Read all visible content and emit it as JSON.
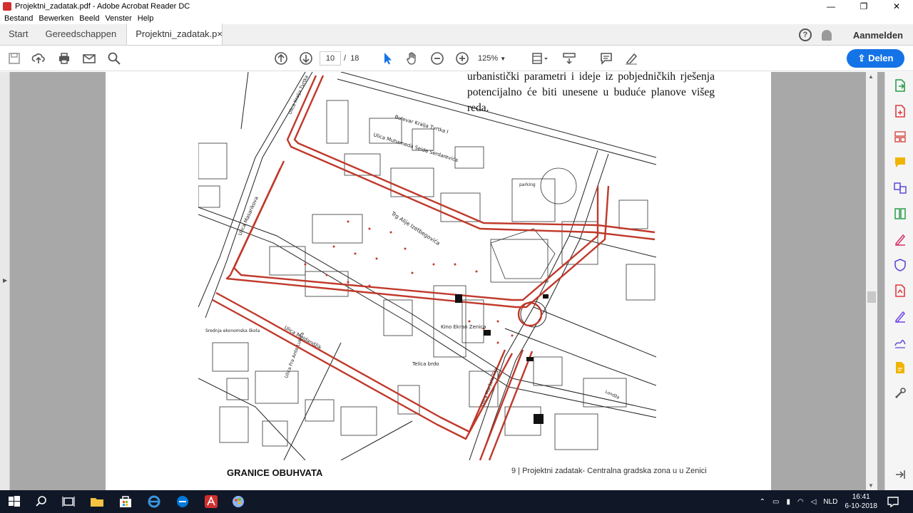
{
  "window": {
    "title": "Projektni_zadatak.pdf - Adobe Acrobat Reader DC",
    "minimize": "—",
    "maximize": "❐",
    "close": "✕"
  },
  "menu": [
    "Bestand",
    "Bewerken",
    "Beeld",
    "Venster",
    "Help"
  ],
  "tabs": {
    "home": "Start",
    "tools": "Gereedschappen",
    "document": "Projektni_zadatak.p",
    "close": "×"
  },
  "account": {
    "help": "?",
    "signin": "Aanmelden"
  },
  "toolbar": {
    "current_page": "10",
    "page_separator": "/",
    "total_pages": "18",
    "zoom": "125%",
    "share_label": "Delen"
  },
  "document": {
    "paragraph": "urbanistički parametri i ideje iz pobjedničkih rješenja potencijalno će biti unesene u buduće planove višeg reda.",
    "caption": "GRANICE OBUHVATA",
    "footer": "9 | Projektni zadatak- Centralna gradska zona u u Zenici",
    "map_labels": {
      "street1": "Bulevar Kralja Tvrtka I",
      "street2": "Ulica Muhameda Seida Serdarevića",
      "street3": "Trg Alije Izetbegovića",
      "street4": "Ulica Masarikova",
      "street5": "Ulica Mejdandžik",
      "cinema": "Kino Ekran Zenica",
      "hill": "Telica brdo",
      "school": "Srednja ekonomska škola",
      "street6": "Ulica Kralja Tvrtka",
      "street7": "Ulica Fra Ante Lukića",
      "rv": "Ulica Maršala Tita",
      "street8": "Londža",
      "parking": "parking"
    }
  },
  "taskbar": {
    "lang": "NLD",
    "time": "16:41",
    "date": "6-10-2018"
  },
  "colors": {
    "accent": "#1473e6",
    "boundary": "#c0392b",
    "workspace": "#a8a8a8"
  }
}
